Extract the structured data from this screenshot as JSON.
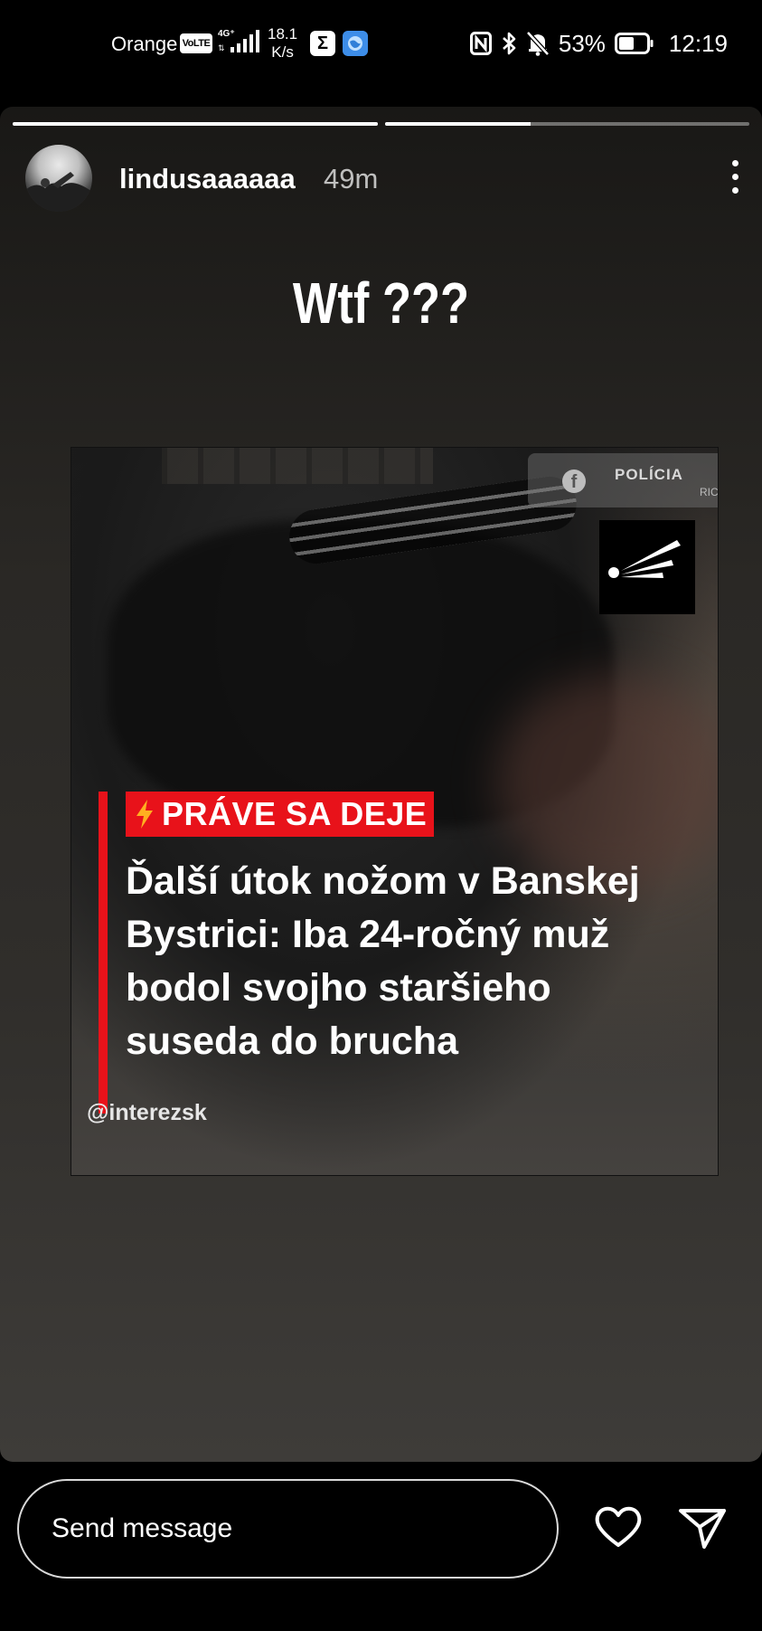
{
  "status_bar": {
    "carrier": "Orange",
    "volte": "VoLTE",
    "network": "4G⁺",
    "speed_value": "18.1",
    "speed_unit": "K/s",
    "sigma_glyph": "Σ",
    "battery_percent": "53%",
    "time": "12:19"
  },
  "story": {
    "progress_segments": [
      1.0,
      0.4
    ],
    "username": "lindusaaaaaa",
    "time_ago": "49m",
    "caption": "Wtf ???",
    "post": {
      "source_badge": "POLÍCIA",
      "source_badge_sub": "RICK",
      "facebook_glyph": "f",
      "breaking_tag": "PRÁVE SA DEJE",
      "headline": "Ďalší útok nožom v Banskej Bystrici: Iba 24-ročný muž bodol svojho staršieho suseda do brucha",
      "accent_color": "#e8121a"
    },
    "mention": "@interezsk"
  },
  "reply_bar": {
    "placeholder": "Send message"
  },
  "icons": {
    "more": "more-vertical-icon",
    "like": "heart-icon",
    "send": "paper-plane-icon"
  }
}
